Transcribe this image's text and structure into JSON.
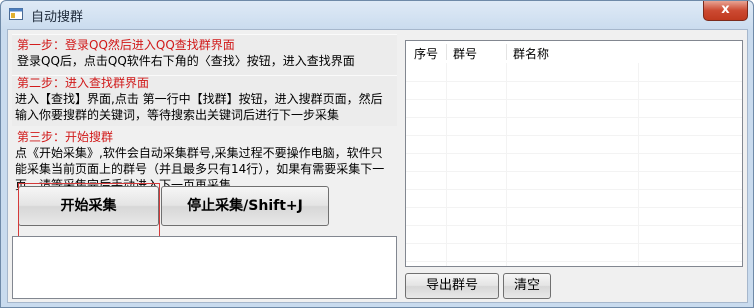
{
  "window": {
    "title": "自动搜群",
    "close_glyph": "x",
    "icon": "window-app-icon"
  },
  "steps": [
    {
      "title": "第一步：登录QQ然后进入QQ查找群界面",
      "lines": [
        "登录QQ后，点击QQ软件右下角的〈查找〉按钮，进入查找界面"
      ]
    },
    {
      "title": "第二步：进入查找群界面",
      "lines": [
        "进入【查找】界面,点击 第一行中【找群】按钮，进入搜群页面，然后",
        "输入你要搜群的关键词，等待搜索出关键词后进行下一步采集"
      ]
    },
    {
      "title": "第三步：开始搜群",
      "lines": [
        "点《开始采集》,软件会自动采集群号,采集过程不要操作电脑，软件只",
        "能采集当前页面上的群号（并且最多只有14行），如果有需要采集下一",
        "页，请等采集完后手动进入下一页再采集。"
      ]
    }
  ],
  "buttons": {
    "start": "开始采集",
    "stop": "停止采集/Shift+J",
    "export": "导出群号",
    "clear": "清空"
  },
  "list": {
    "columns": [
      "序号",
      "群号",
      "群名称"
    ],
    "rows": []
  },
  "colors": {
    "step_title": "#d11a1a",
    "highlight_border": "#d43a3a",
    "close_button": "#c0391f"
  }
}
